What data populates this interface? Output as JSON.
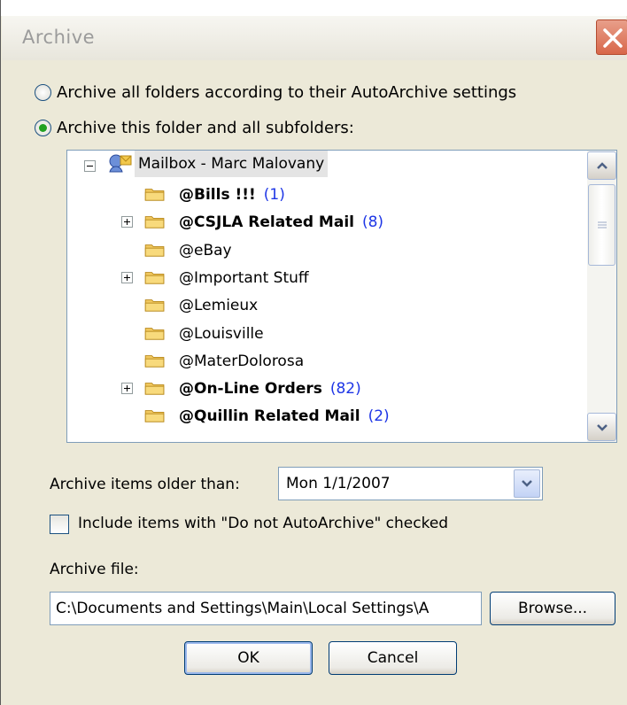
{
  "window": {
    "title": "Archive"
  },
  "options": {
    "archive_all_label": "Archive all folders according to their AutoArchive settings",
    "archive_this_label": "Archive this folder and all subfolders:",
    "selected": "archive_this"
  },
  "tree": {
    "root_label": "Mailbox - Marc Malovany",
    "items": [
      {
        "name": "@Bills !!!",
        "count": "(1)",
        "bold": true,
        "expandable": false
      },
      {
        "name": "@CSJLA Related Mail",
        "count": "(8)",
        "bold": true,
        "expandable": true
      },
      {
        "name": "@eBay",
        "count": "",
        "bold": false,
        "expandable": false
      },
      {
        "name": "@Important Stuff",
        "count": "",
        "bold": false,
        "expandable": true
      },
      {
        "name": "@Lemieux",
        "count": "",
        "bold": false,
        "expandable": false
      },
      {
        "name": "@Louisville",
        "count": "",
        "bold": false,
        "expandable": false
      },
      {
        "name": "@MaterDolorosa",
        "count": "",
        "bold": false,
        "expandable": false
      },
      {
        "name": "@On-Line Orders",
        "count": "(82)",
        "bold": true,
        "expandable": true
      },
      {
        "name": "@Quillin Related Mail",
        "count": "(2)",
        "bold": true,
        "expandable": false
      }
    ]
  },
  "archive_older": {
    "label": "Archive items older than:",
    "value": "Mon 1/1/2007"
  },
  "include_checkbox": {
    "label": "Include items with \"Do not AutoArchive\" checked",
    "checked": false
  },
  "archive_file": {
    "label": "Archive file:",
    "value": "C:\\Documents and Settings\\Main\\Local Settings\\A",
    "browse_label": "Browse..."
  },
  "buttons": {
    "ok": "OK",
    "cancel": "Cancel"
  },
  "colors": {
    "count_blue": "#1e36e6",
    "dialog_bg": "#ece9d8",
    "radio_green": "#21a121"
  }
}
